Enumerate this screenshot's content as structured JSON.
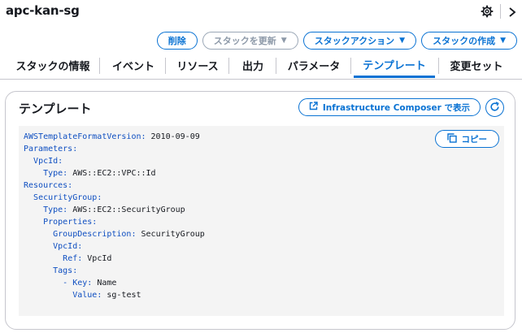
{
  "header": {
    "title": "apc-kan-sg"
  },
  "actions": {
    "delete_label": "削除",
    "update_label": "スタックを更新",
    "stack_actions_label": "スタックアクション",
    "create_label": "スタックの作成"
  },
  "tabs": [
    {
      "label": "スタックの情報"
    },
    {
      "label": "イベント"
    },
    {
      "label": "リソース"
    },
    {
      "label": "出力"
    },
    {
      "label": "パラメータ"
    },
    {
      "label": "テンプレート",
      "active": true
    },
    {
      "label": "変更セット"
    }
  ],
  "panel": {
    "title": "テンプレート",
    "composer_label": "Infrastructure Composer で表示",
    "copy_label": "コピー"
  },
  "template": {
    "lines": [
      {
        "indent": "",
        "key": "AWSTemplateFormatVersion:",
        "value": " 2010-09-09"
      },
      {
        "indent": "",
        "key": "Parameters:",
        "value": ""
      },
      {
        "indent": "  ",
        "key": "VpcId:",
        "value": ""
      },
      {
        "indent": "    ",
        "key": "Type:",
        "value": " AWS::EC2::VPC::Id"
      },
      {
        "indent": "",
        "key": "Resources:",
        "value": ""
      },
      {
        "indent": "  ",
        "key": "SecurityGroup:",
        "value": ""
      },
      {
        "indent": "    ",
        "key": "Type:",
        "value": " AWS::EC2::SecurityGroup"
      },
      {
        "indent": "    ",
        "key": "Properties:",
        "value": ""
      },
      {
        "indent": "      ",
        "key": "GroupDescription:",
        "value": " SecurityGroup"
      },
      {
        "indent": "      ",
        "key": "VpcId:",
        "value": ""
      },
      {
        "indent": "        ",
        "key": "Ref:",
        "value": " VpcId"
      },
      {
        "indent": "      ",
        "key": "Tags:",
        "value": ""
      },
      {
        "indent": "        ",
        "key": "- Key:",
        "value": " Name"
      },
      {
        "indent": "          ",
        "key": "Value:",
        "value": " sg-test"
      }
    ]
  },
  "colors": {
    "accent": "#0972d3",
    "code_key": "#0f4fc1",
    "code_bg": "#f4f4f4",
    "disabled": "#8d99a8"
  },
  "icons": {
    "settings": "gear-icon",
    "collapse": "chevron-right-icon",
    "external": "external-link-icon",
    "refresh": "refresh-icon",
    "copy": "copy-icon",
    "dropdown": "caret-down-icon"
  }
}
